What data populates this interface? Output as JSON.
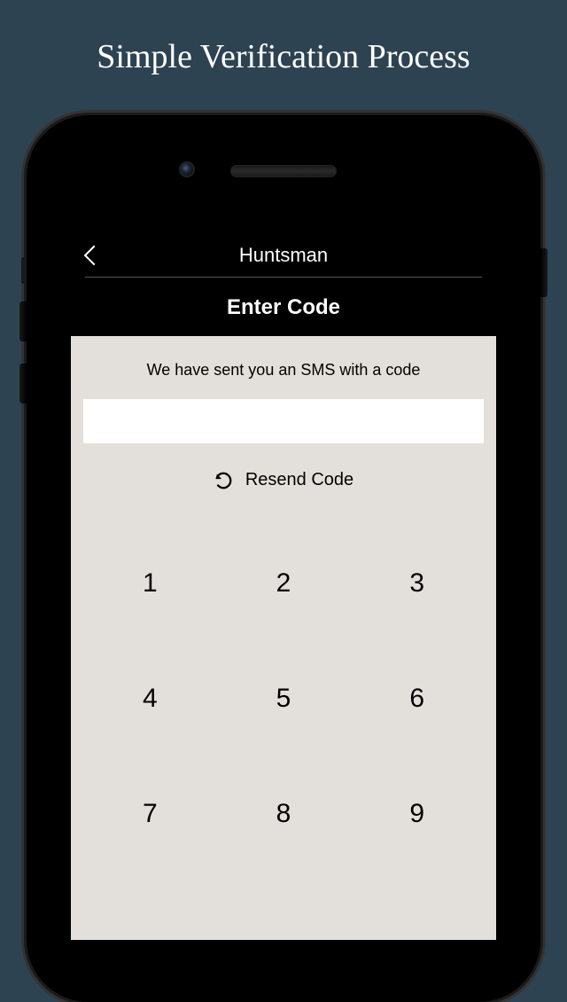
{
  "marketing": {
    "title": "Simple Verification Process"
  },
  "header": {
    "title": "Huntsman",
    "subtitle": "Enter Code"
  },
  "content": {
    "instruction": "We have sent you an SMS with a code",
    "code_value": "",
    "resend_label": "Resend Code"
  },
  "keypad": {
    "keys": [
      "1",
      "2",
      "3",
      "4",
      "5",
      "6",
      "7",
      "8",
      "9"
    ]
  }
}
